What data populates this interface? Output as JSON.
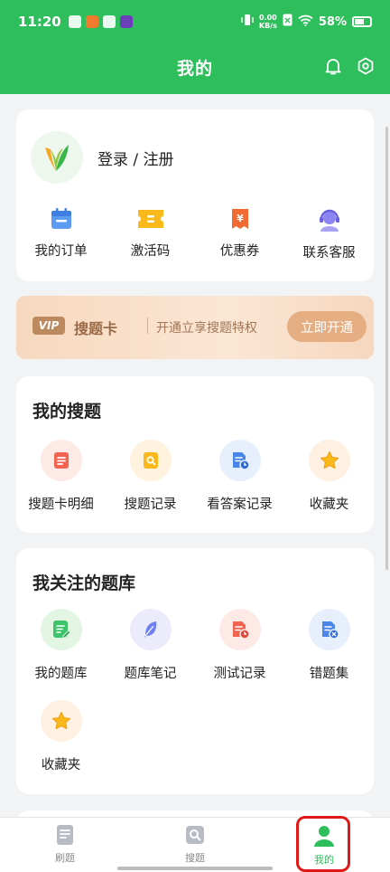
{
  "status_bar": {
    "time": "11:20",
    "net_speed_value": "0.00",
    "net_speed_unit": "KB/s",
    "battery": "58%"
  },
  "header": {
    "title": "我的"
  },
  "profile": {
    "login_label": "登录 / 注册",
    "items": [
      {
        "label": "我的订单",
        "icon": "calendar-icon"
      },
      {
        "label": "激活码",
        "icon": "ticket-icon"
      },
      {
        "label": "优惠券",
        "icon": "coupon-icon"
      },
      {
        "label": "联系客服",
        "icon": "headset-icon"
      }
    ]
  },
  "vip": {
    "badge": "VIP",
    "name": "搜题卡",
    "desc": "开通立享搜题特权",
    "button": "立即开通"
  },
  "my_search": {
    "title": "我的搜题",
    "items": [
      {
        "label": "搜题卡明细",
        "icon": "list-doc-icon"
      },
      {
        "label": "搜题记录",
        "icon": "search-doc-icon"
      },
      {
        "label": "看答案记录",
        "icon": "doc-clock-icon"
      },
      {
        "label": "收藏夹",
        "icon": "star-icon"
      }
    ]
  },
  "my_banks": {
    "title": "我关注的题库",
    "items": [
      {
        "label": "我的题库",
        "icon": "edit-doc-icon"
      },
      {
        "label": "题库笔记",
        "icon": "feather-icon"
      },
      {
        "label": "测试记录",
        "icon": "doc-clock-icon"
      },
      {
        "label": "错题集",
        "icon": "doc-x-icon"
      },
      {
        "label": "收藏夹",
        "icon": "star-icon"
      }
    ]
  },
  "tabbar": {
    "tabs": [
      {
        "label": "刷题"
      },
      {
        "label": "搜题"
      },
      {
        "label": "我的"
      }
    ]
  },
  "colors": {
    "brand_green": "#2fbe5c",
    "vip_gold": "#e5ae82",
    "highlight_red": "#e01818"
  }
}
